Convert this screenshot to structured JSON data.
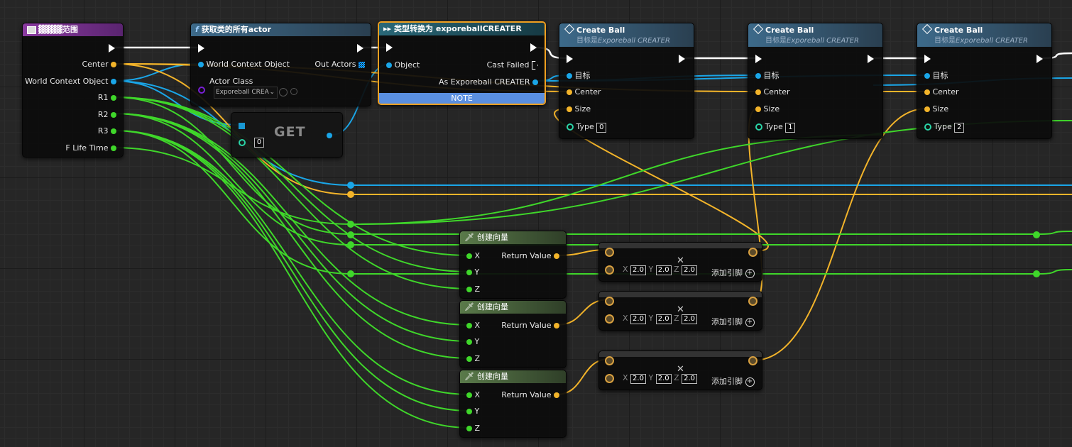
{
  "colors": {
    "exec": "#ffffff",
    "vector": "#f3b42a",
    "object": "#1aa6e8",
    "float": "#3fd72a",
    "class": "#7a1fd6",
    "note_bg": "#5a8fe0",
    "cast_hdr": "#1e5a6e",
    "func_hdr": "#2f4f66",
    "event_hdr": "#7a2f8c",
    "make_hdr": "#4f6a3f"
  },
  "range_node": {
    "title": "▓▓▓▓范围",
    "pins": [
      "Center",
      "World Context Object",
      "R1",
      "R2",
      "R3",
      "F Life Time"
    ],
    "icon": "function-icon"
  },
  "get_all_actors": {
    "title": "获取类的所有actor",
    "icon": "function-f-icon",
    "in_wco": "World Context Object",
    "in_class": "Actor Class",
    "class_value": "Exporeball CREA",
    "out_actors": "Out Actors"
  },
  "cast_node": {
    "title": "类型转换为 exporeballCREATER",
    "icon": "cast-icon",
    "object": "Object",
    "cast_failed": "Cast Failed",
    "as_out": "As Exporeball CREATER",
    "note": "NOTE"
  },
  "get_node": {
    "label": "GET",
    "index": "0"
  },
  "create_ball_nodes": [
    {
      "title": "Create Ball",
      "target_line": "目标是",
      "target_class": "Exporeball CREATER",
      "pin_target": "目标",
      "pin_center": "Center",
      "pin_size": "Size",
      "pin_type": "Type",
      "type_value": "0"
    },
    {
      "title": "Create Ball",
      "target_line": "目标是",
      "target_class": "Exporeball CREATER",
      "pin_target": "目标",
      "pin_center": "Center",
      "pin_size": "Size",
      "pin_type": "Type",
      "type_value": "1"
    },
    {
      "title": "Create Ball",
      "target_line": "目标是",
      "target_class": "Exporeball CREATER",
      "pin_target": "目标",
      "pin_center": "Center",
      "pin_size": "Size",
      "pin_type": "Type",
      "type_value": "2"
    }
  ],
  "make_vector_nodes": [
    {
      "title": "创建向量",
      "x": "X",
      "y": "Y",
      "z": "Z",
      "ret": "Return Value"
    },
    {
      "title": "创建向量",
      "x": "X",
      "y": "Y",
      "z": "Z",
      "ret": "Return Value"
    },
    {
      "title": "创建向量",
      "x": "X",
      "y": "Y",
      "z": "Z",
      "ret": "Return Value"
    }
  ],
  "multiply_nodes": [
    {
      "x_label": "X",
      "x_val": "2.0",
      "y_label": "Y",
      "y_val": "2.0",
      "z_label": "Z",
      "z_val": "2.0",
      "add_pin": "添加引脚"
    },
    {
      "x_label": "X",
      "x_val": "2.0",
      "y_label": "Y",
      "y_val": "2.0",
      "z_label": "Z",
      "z_val": "2.0",
      "add_pin": "添加引脚"
    },
    {
      "x_label": "X",
      "x_val": "2.0",
      "y_label": "Y",
      "y_val": "2.0",
      "z_label": "Z",
      "z_val": "2.0",
      "add_pin": "添加引脚"
    }
  ]
}
